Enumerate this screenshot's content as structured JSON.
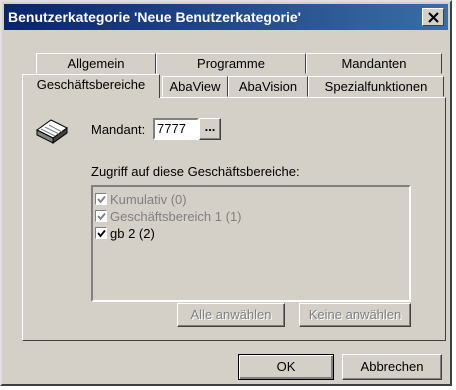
{
  "window": {
    "title": "Benutzerkategorie 'Neue Benutzerkategorie'",
    "close_label": "×"
  },
  "tabs": {
    "row_back": [
      "Allgemein",
      "Programme",
      "Mandanten"
    ],
    "row_front": [
      "Geschäftsbereiche",
      "AbaView",
      "AbaVision",
      "Spezialfunktionen"
    ],
    "active": "Geschäftsbereiche"
  },
  "form": {
    "mandant_label": "Mandant:",
    "mandant_value": "7777",
    "browse_label": "...",
    "access_label": "Zugriff auf diese Geschäftsbereiche:",
    "items": [
      {
        "label": "Kumulativ (0)",
        "checked": true,
        "enabled": false
      },
      {
        "label": "Geschäftsbereich 1 (1)",
        "checked": true,
        "enabled": false
      },
      {
        "label": "gb 2 (2)",
        "checked": true,
        "enabled": true
      }
    ],
    "select_all_label": "Alle anwählen",
    "select_none_label": "Keine anwählen"
  },
  "footer": {
    "ok_label": "OK",
    "cancel_label": "Abbrechen"
  },
  "icons": {
    "category": "book-stack-icon",
    "checkbox": "checkmark-icon"
  }
}
